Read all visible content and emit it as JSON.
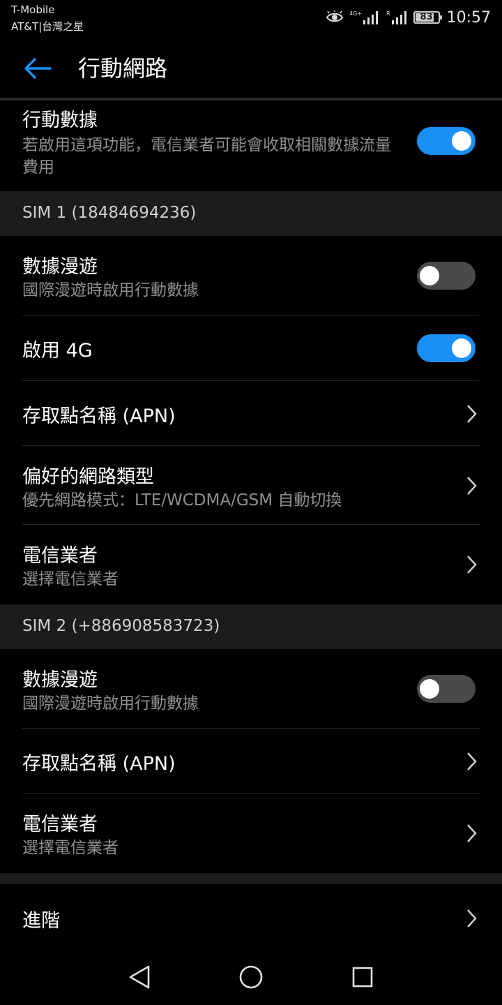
{
  "status_bar": {
    "carrier_primary": "T-Mobile",
    "carrier_secondary": "AT&T|台灣之星",
    "network_label": "4G+",
    "roaming_label": "R",
    "battery_level": 83,
    "battery_text": "83",
    "time": "10:57"
  },
  "app_bar": {
    "title": "行動網路",
    "back_icon": "arrow-left-icon",
    "accent_color": "#1a8ff5"
  },
  "mobile_data": {
    "title": "行動數據",
    "subtitle": "若啟用這項功能，電信業者可能會收取相關數據流量費用",
    "enabled": true
  },
  "sim1": {
    "header": "SIM 1 (18484694236)",
    "roaming": {
      "title": "數據漫遊",
      "subtitle": "國際漫遊時啟用行動數據",
      "enabled": false
    },
    "enable_4g": {
      "title": "啟用 4G",
      "enabled": true
    },
    "apn": {
      "title": "存取點名稱 (APN)"
    },
    "network_type": {
      "title": "偏好的網路類型",
      "subtitle": "優先網路模式：LTE/WCDMA/GSM 自動切換"
    },
    "carrier": {
      "title": "電信業者",
      "subtitle": "選擇電信業者"
    }
  },
  "sim2": {
    "header": "SIM 2 (+886908583723)",
    "roaming": {
      "title": "數據漫遊",
      "subtitle": "國際漫遊時啟用行動數據",
      "enabled": false
    },
    "apn": {
      "title": "存取點名稱 (APN)"
    },
    "carrier": {
      "title": "電信業者",
      "subtitle": "選擇電信業者"
    }
  },
  "advanced": {
    "title": "進階"
  },
  "nav_bar": {
    "back_icon": "triangle-back-icon",
    "home_icon": "circle-home-icon",
    "recents_icon": "square-recents-icon"
  }
}
